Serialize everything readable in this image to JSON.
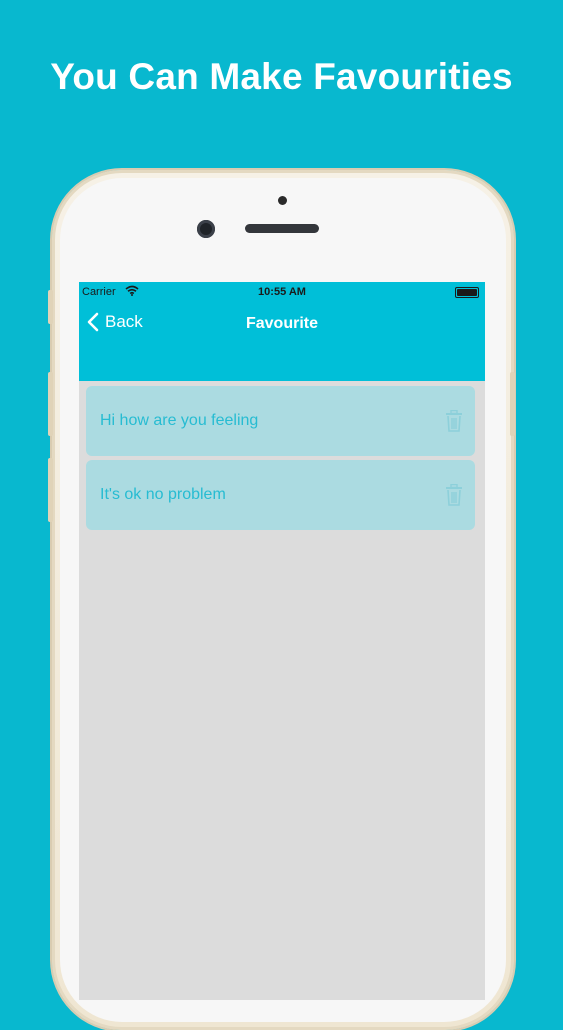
{
  "headline": "You Can Make Favourities",
  "status_bar": {
    "carrier": "Carrier",
    "time": "10:55 AM"
  },
  "nav": {
    "back_label": "Back",
    "title": "Favourite"
  },
  "favourites": [
    {
      "text": "Hi how are you feeling",
      "icon": "trash-icon"
    },
    {
      "text": "It's ok no problem",
      "icon": "trash-icon"
    }
  ],
  "colors": {
    "background": "#08b8cf",
    "navbar": "#00bfd8",
    "row": "#abdbe1",
    "row_text": "#27bcd2"
  }
}
